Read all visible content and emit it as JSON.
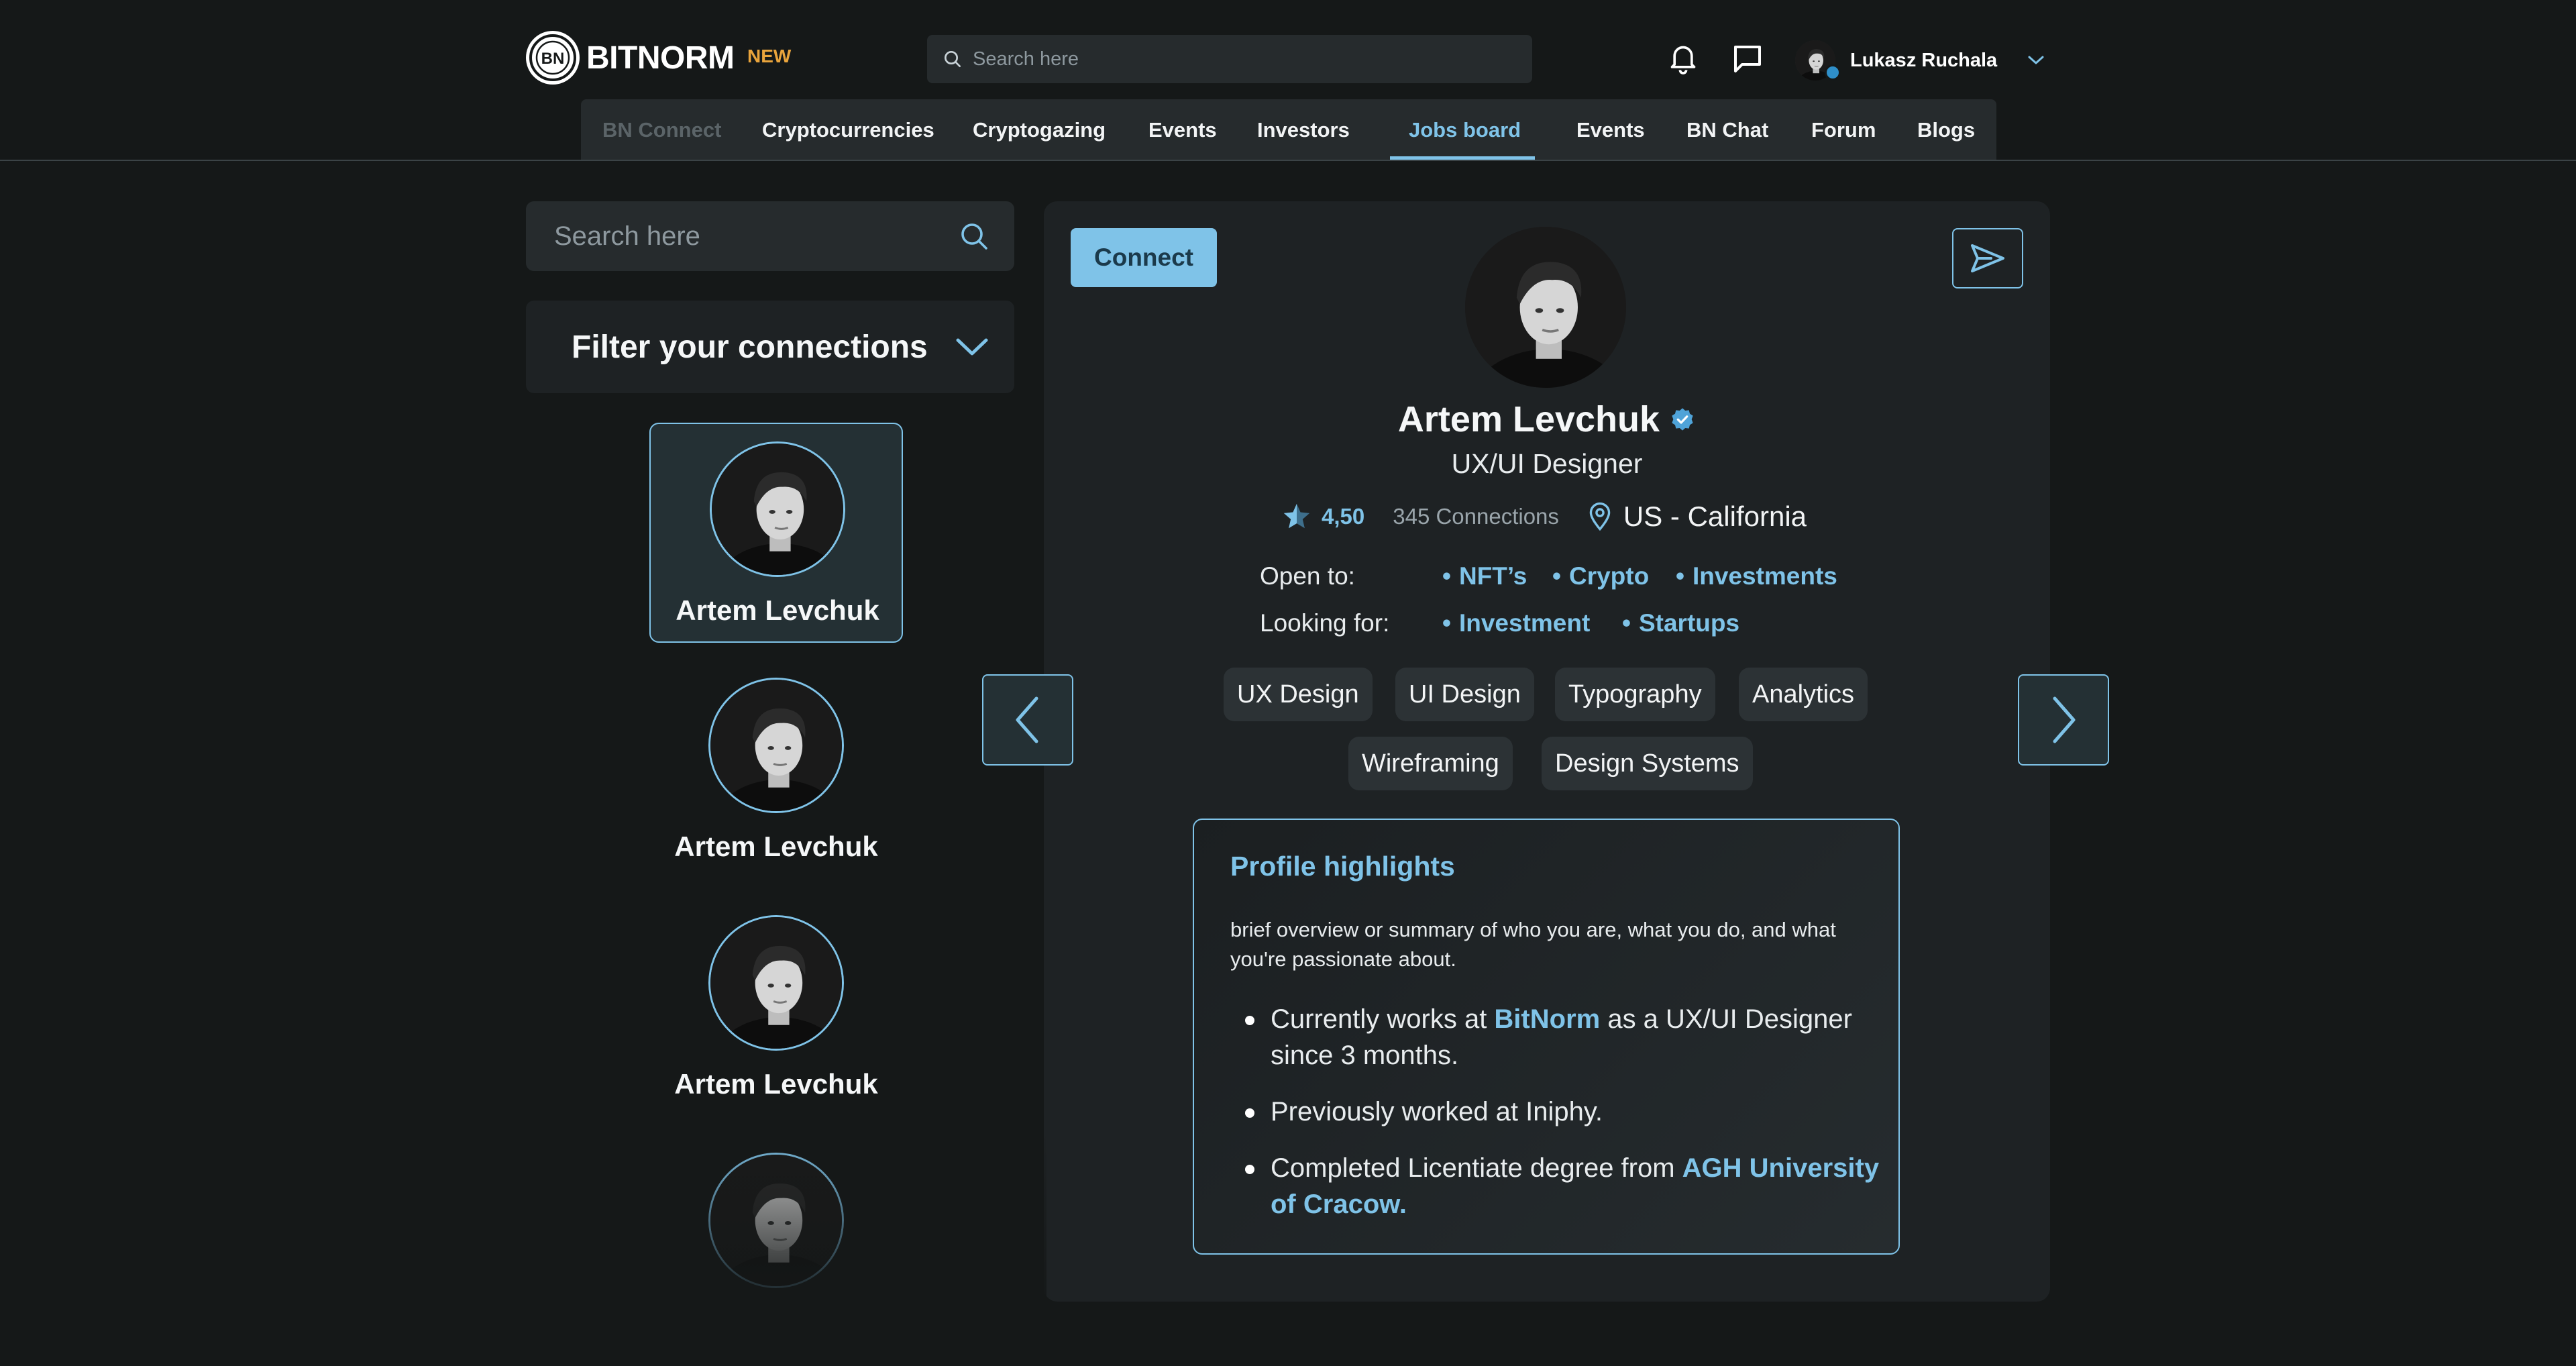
{
  "header": {
    "logo_mark": "BN",
    "logo_text": "BITNORM",
    "badge": "NEW",
    "search_placeholder": "Search here",
    "icons": [
      "bell-icon",
      "chat-icon",
      "chevron-down-icon"
    ],
    "user_name": "Lukasz Ruchala"
  },
  "nav": {
    "items": [
      {
        "label": "BN Connect",
        "state": "disabled"
      },
      {
        "label": "Cryptocurrencies"
      },
      {
        "label": "Cryptogazing"
      },
      {
        "label": "Events"
      },
      {
        "label": "Investors"
      },
      {
        "label": "Jobs board",
        "state": "active"
      },
      {
        "label": "Events"
      },
      {
        "label": "BN Chat"
      },
      {
        "label": "Forum"
      },
      {
        "label": "Blogs"
      }
    ]
  },
  "sidebar": {
    "search_placeholder": "Search here",
    "filter_label": "Filter your connections",
    "connections": [
      {
        "name": "Artem Levchuk",
        "selected": true
      },
      {
        "name": "Artem Levchuk"
      },
      {
        "name": "Artem Levchuk"
      },
      {
        "name": ""
      }
    ]
  },
  "profile": {
    "connect_label": "Connect",
    "name": "Artem Levchuk",
    "verified": true,
    "role": "UX/UI Designer",
    "rating": "4,50",
    "connections": "345 Connections",
    "location": "US - California",
    "open_to_label": "Open to:",
    "open_to": [
      "NFT’s",
      "Crypto",
      "Investments"
    ],
    "looking_for_label": "Looking for:",
    "looking_for": [
      "Investment",
      "Startups"
    ],
    "skills": [
      "UX Design",
      "UI Design",
      "Typography",
      "Analytics",
      "Wireframing",
      "Design Systems"
    ],
    "highlights": {
      "title": "Profile highlights",
      "summary": "brief overview or summary of who you are, what you do, and what you're passionate about.",
      "item1_pre": "Currently works at ",
      "item1_link": "BitNorm",
      "item1_post": " as a UX/UI Designer since 3 months.",
      "item2": "Previously worked at Iniphy.",
      "item3_pre": "Completed Licentiate degree from ",
      "item3_link": "AGH University of Cracow."
    }
  },
  "colors": {
    "background": "#151818",
    "panel": "#1e2224",
    "accent": "#7fc3e8",
    "badge": "#e9a43c"
  }
}
